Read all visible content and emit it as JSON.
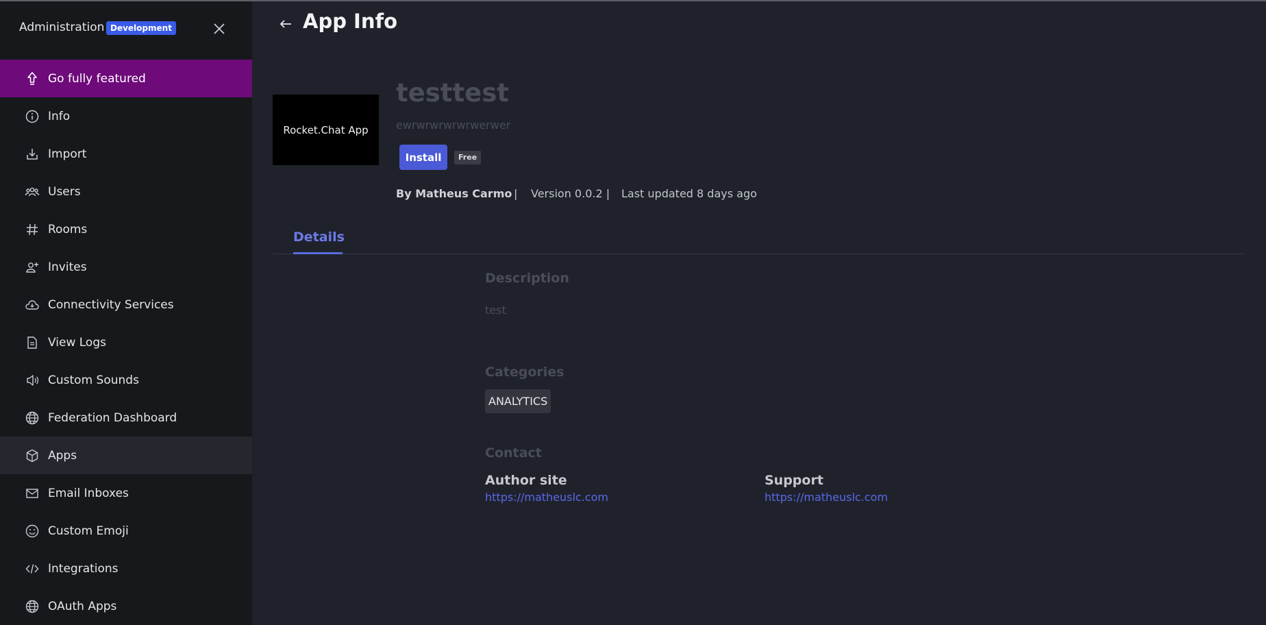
{
  "sidebar": {
    "title": "Administration",
    "badge": "Development",
    "items": [
      {
        "label": "Go fully featured",
        "icon": "rocket-icon"
      },
      {
        "label": "Info",
        "icon": "info-icon"
      },
      {
        "label": "Import",
        "icon": "import-icon"
      },
      {
        "label": "Users",
        "icon": "users-icon"
      },
      {
        "label": "Rooms",
        "icon": "hashtag-icon"
      },
      {
        "label": "Invites",
        "icon": "user-plus-icon"
      },
      {
        "label": "Connectivity Services",
        "icon": "cloud-icon"
      },
      {
        "label": "View Logs",
        "icon": "file-icon"
      },
      {
        "label": "Custom Sounds",
        "icon": "sound-icon"
      },
      {
        "label": "Federation Dashboard",
        "icon": "globe-icon"
      },
      {
        "label": "Apps",
        "icon": "cube-icon"
      },
      {
        "label": "Email Inboxes",
        "icon": "mail-icon"
      },
      {
        "label": "Custom Emoji",
        "icon": "emoji-icon"
      },
      {
        "label": "Integrations",
        "icon": "code-icon"
      },
      {
        "label": "OAuth Apps",
        "icon": "globe-icon"
      }
    ]
  },
  "header": {
    "title": "App Info"
  },
  "app": {
    "logo_text": "Rocket.Chat App",
    "name": "testtest",
    "short_description": "ewrwrwrwrwrwerwer",
    "install_label": "Install",
    "price_badge": "Free",
    "author": "By Matheus Carmo",
    "separator": "|",
    "version": "Version 0.0.2 |",
    "updated": "Last updated 8 days ago"
  },
  "tabs": {
    "details": "Details"
  },
  "details": {
    "description_heading": "Description",
    "description_text": "test",
    "categories_heading": "Categories",
    "categories": [
      "ANALYTICS"
    ],
    "contact_heading": "Contact",
    "author_site_label": "Author site",
    "author_site_url": "https://matheuslc.com",
    "support_label": "Support",
    "support_url": "https://matheuslc.com"
  },
  "colors": {
    "sidebar_bg": "#17181c",
    "main_bg": "#1f222b",
    "featured_bg": "#6e0a7a",
    "accent": "#4b5ad6",
    "link": "#5a68ea"
  }
}
